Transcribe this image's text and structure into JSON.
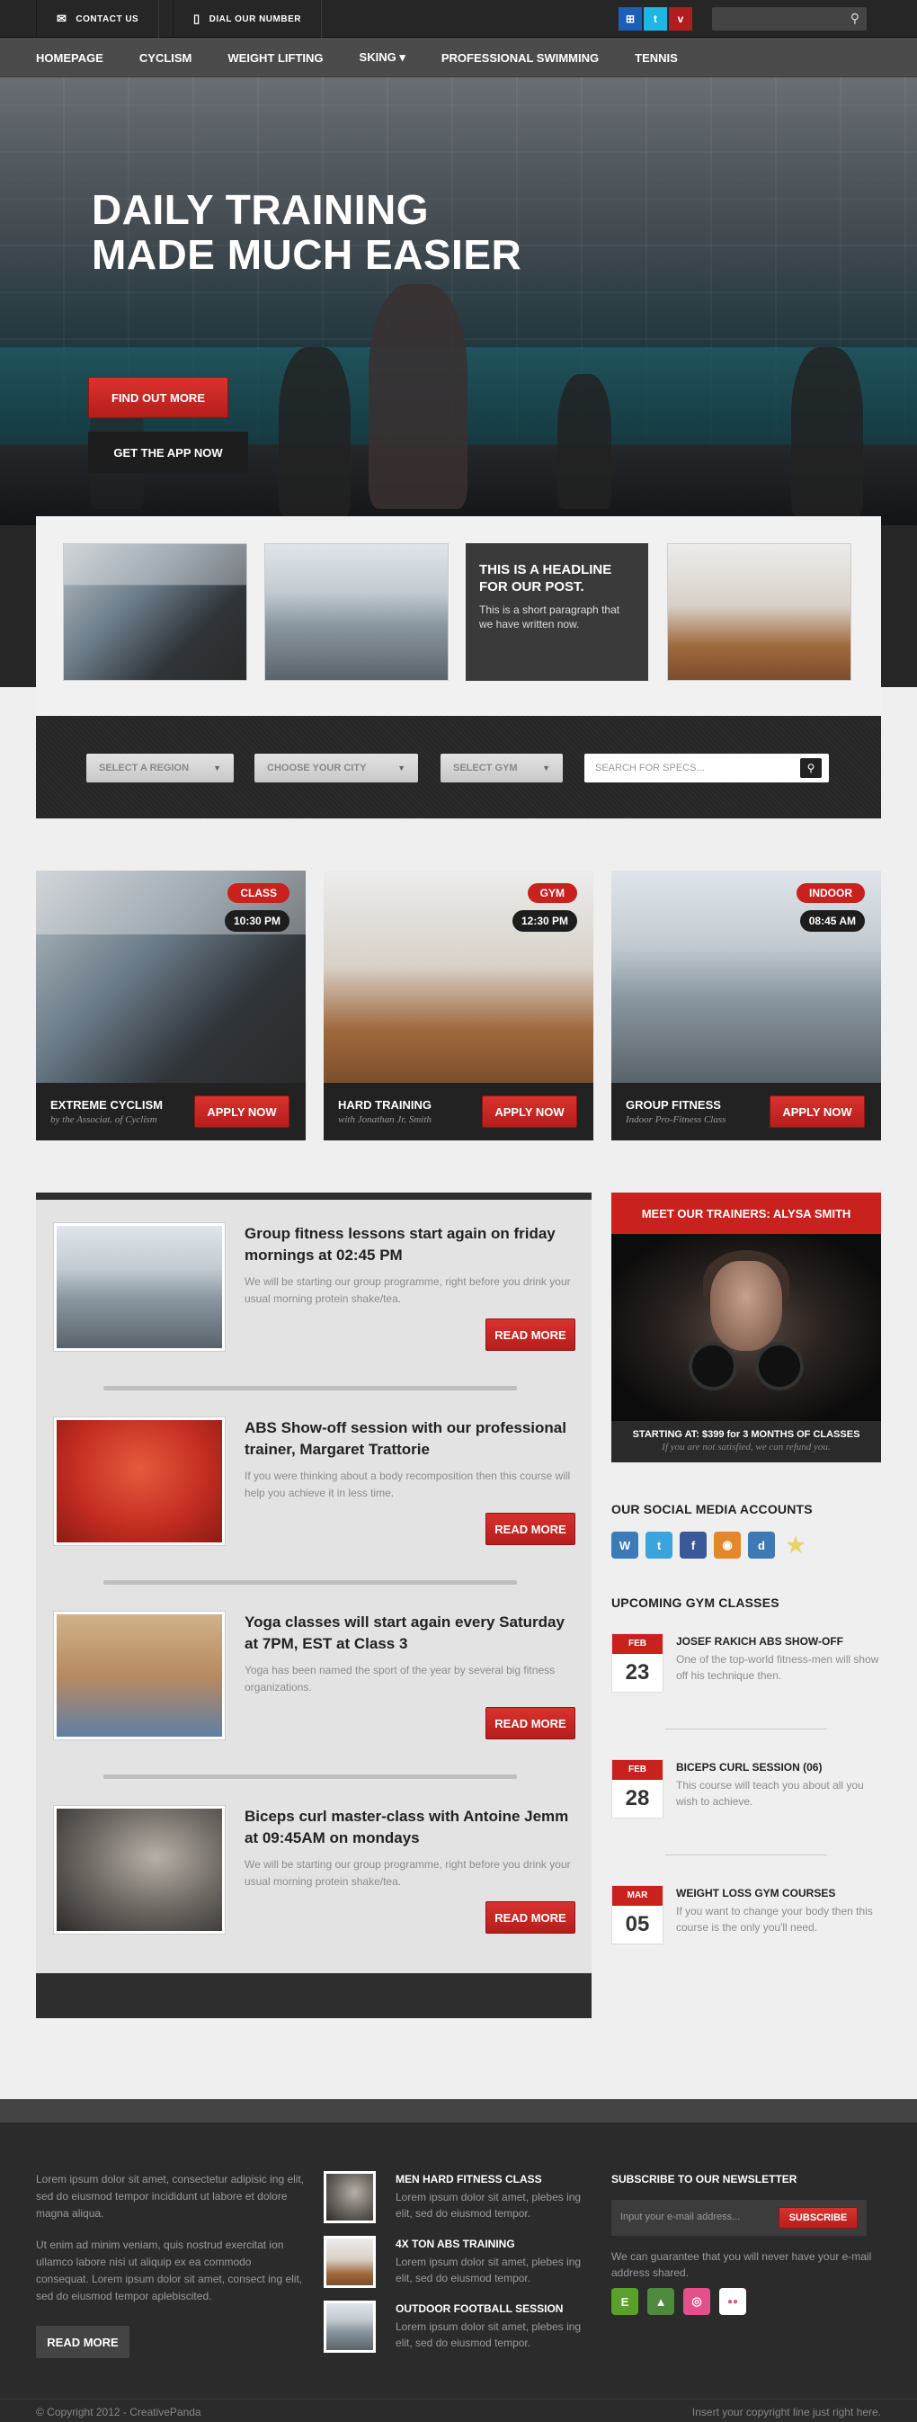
{
  "topbar": {
    "contact": "CONTACT US",
    "dial": "DIAL OUR NUMBER",
    "social": [
      {
        "icon": "windows-icon",
        "glyph": "⊞",
        "color": "#1c5fb6"
      },
      {
        "icon": "twitter-icon",
        "glyph": "t",
        "color": "#1eb6e2"
      },
      {
        "icon": "vimeo-icon",
        "glyph": "v",
        "color": "#b11c1c"
      }
    ]
  },
  "nav": [
    "HOMEPAGE",
    "CYCLISM",
    "WEIGHT LIFTING",
    "SKING ▾",
    "PROFESSIONAL SWIMMING",
    "TENNIS"
  ],
  "hero": {
    "line1": "DAILY TRAINING",
    "line2": "MADE MUCH EASIER",
    "btn1": "FIND OUT MORE",
    "btn2": "GET THE APP NOW"
  },
  "featured": {
    "headline": "THIS IS A HEADLINE FOR OUR POST.",
    "paragraph": "This is a short paragraph that we have written now."
  },
  "search": {
    "region": "SELECT A REGION",
    "city": "CHOOSE YOUR CITY",
    "gym": "SELECT GYM",
    "placeholder": "SEARCH FOR SPECS..."
  },
  "cards": [
    {
      "badge": "CLASS",
      "time": "10:30 PM",
      "title": "EXTREME CYCLISM",
      "sub": "by the Associat. of Cyclism",
      "apply": "APPLY NOW"
    },
    {
      "badge": "GYM",
      "time": "12:30 PM",
      "title": "HARD TRAINING",
      "sub": "with Jonathan Jr. Smith",
      "apply": "APPLY NOW"
    },
    {
      "badge": "INDOOR",
      "time": "08:45 AM",
      "title": "GROUP FITNESS",
      "sub": "Indoor Pro-Fitness Class",
      "apply": "APPLY NOW"
    }
  ],
  "posts": [
    {
      "title": "Group fitness lessons start again on friday mornings at 02:45 PM",
      "text": "We will be starting our group programme, right before you drink your usual morning protein shake/tea.",
      "button": "READ MORE"
    },
    {
      "title": "ABS Show-off session with our professional trainer, Margaret Trattorie",
      "text": "If you were thinking about a body recomposition then this course will help you achieve it in less time.",
      "button": "READ MORE"
    },
    {
      "title": "Yoga classes will start again every Saturday at 7PM, EST at Class 3",
      "text": "Yoga has been named the sport of the year by several big fitness organizations.",
      "button": "READ MORE"
    },
    {
      "title": "Biceps curl master-class with Antoine Jemm at 09:45AM on mondays",
      "text": "We will be starting our group programme, right before you drink your usual morning protein shake/tea.",
      "button": "READ MORE"
    }
  ],
  "trainer": {
    "title": "MEET OUR TRAINERS: ALYSA SMITH",
    "price": "STARTING AT: $399 for 3 MONTHS OF CLASSES",
    "note": "If you are not satisfied, we can refund you."
  },
  "social": {
    "title": "OUR SOCIAL MEDIA ACCOUNTS",
    "icons": [
      {
        "icon": "wordpress-icon",
        "glyph": "W",
        "color": "#3a7bb8"
      },
      {
        "icon": "twitter-icon",
        "glyph": "t",
        "color": "#3aa4de"
      },
      {
        "icon": "facebook-icon",
        "glyph": "f",
        "color": "#3b5998"
      },
      {
        "icon": "rss-icon",
        "glyph": "◉",
        "color": "#e4862a"
      },
      {
        "icon": "digg-icon",
        "glyph": "d",
        "color": "#3d79b4"
      },
      {
        "icon": "star-icon",
        "glyph": "★",
        "color": "#e9d36a"
      }
    ]
  },
  "classes": {
    "title": "UPCOMING GYM CLASSES",
    "items": [
      {
        "month": "FEB",
        "day": "23",
        "title": "JOSEF RAKICH ABS SHOW-OFF",
        "desc": "One of the top-world fitness-men will show off his technique then."
      },
      {
        "month": "FEB",
        "day": "28",
        "title": "BICEPS CURL SESSION (06)",
        "desc": "This course will teach you about all you wish to achieve."
      },
      {
        "month": "MAR",
        "day": "05",
        "title": "WEIGHT LOSS GYM COURSES",
        "desc": "If you want to change your body then this course is the only you'll need."
      }
    ]
  },
  "footer": {
    "p1": "Lorem ipsum dolor sit amet, consectetur adipisic ing elit, sed do eiusmod tempor incididunt ut labore et dolore magna aliqua.",
    "p2": "Ut enim ad minim veniam, quis nostrud exercitat ion ullamco labore nisi ut aliquip ex ea commodo consequat. Lorem ipsum dolor sit amet, consect ing elit, sed do eiusmod tempor aplebiscited.",
    "readmore": "READ MORE",
    "items": [
      {
        "title": "MEN HARD FITNESS CLASS",
        "desc": "Lorem ipsum dolor sit amet, plebes ing elit, sed do eiusmod tempor."
      },
      {
        "title": "4X TON ABS TRAINING",
        "desc": "Lorem ipsum dolor sit amet, plebes ing elit, sed do eiusmod tempor."
      },
      {
        "title": "OUTDOOR FOOTBALL SESSION",
        "desc": "Lorem ipsum dolor sit amet, plebes ing elit, sed do eiusmod tempor."
      }
    ],
    "newsletter_title": "SUBSCRIBE TO OUR NEWSLETTER",
    "newsletter_placeholder": "Input your e-mail address...",
    "subscribe": "SUBSCRIBE",
    "newsletter_note": "We can guarantee that you will never have your e-mail address shared.",
    "social": [
      {
        "icon": "evernote-icon",
        "glyph": "E",
        "color": "#5aa12b"
      },
      {
        "icon": "forrst-icon",
        "glyph": "▲",
        "color": "#4d8a3e"
      },
      {
        "icon": "dribbble-icon",
        "glyph": "◎",
        "color": "#e4508a"
      },
      {
        "icon": "flickr-icon",
        "glyph": "●●",
        "color": "#ffffff"
      }
    ],
    "copyright": "© Copyright 2012 - CreativePanda",
    "copyright_right": "Insert your copyright line just right here."
  }
}
